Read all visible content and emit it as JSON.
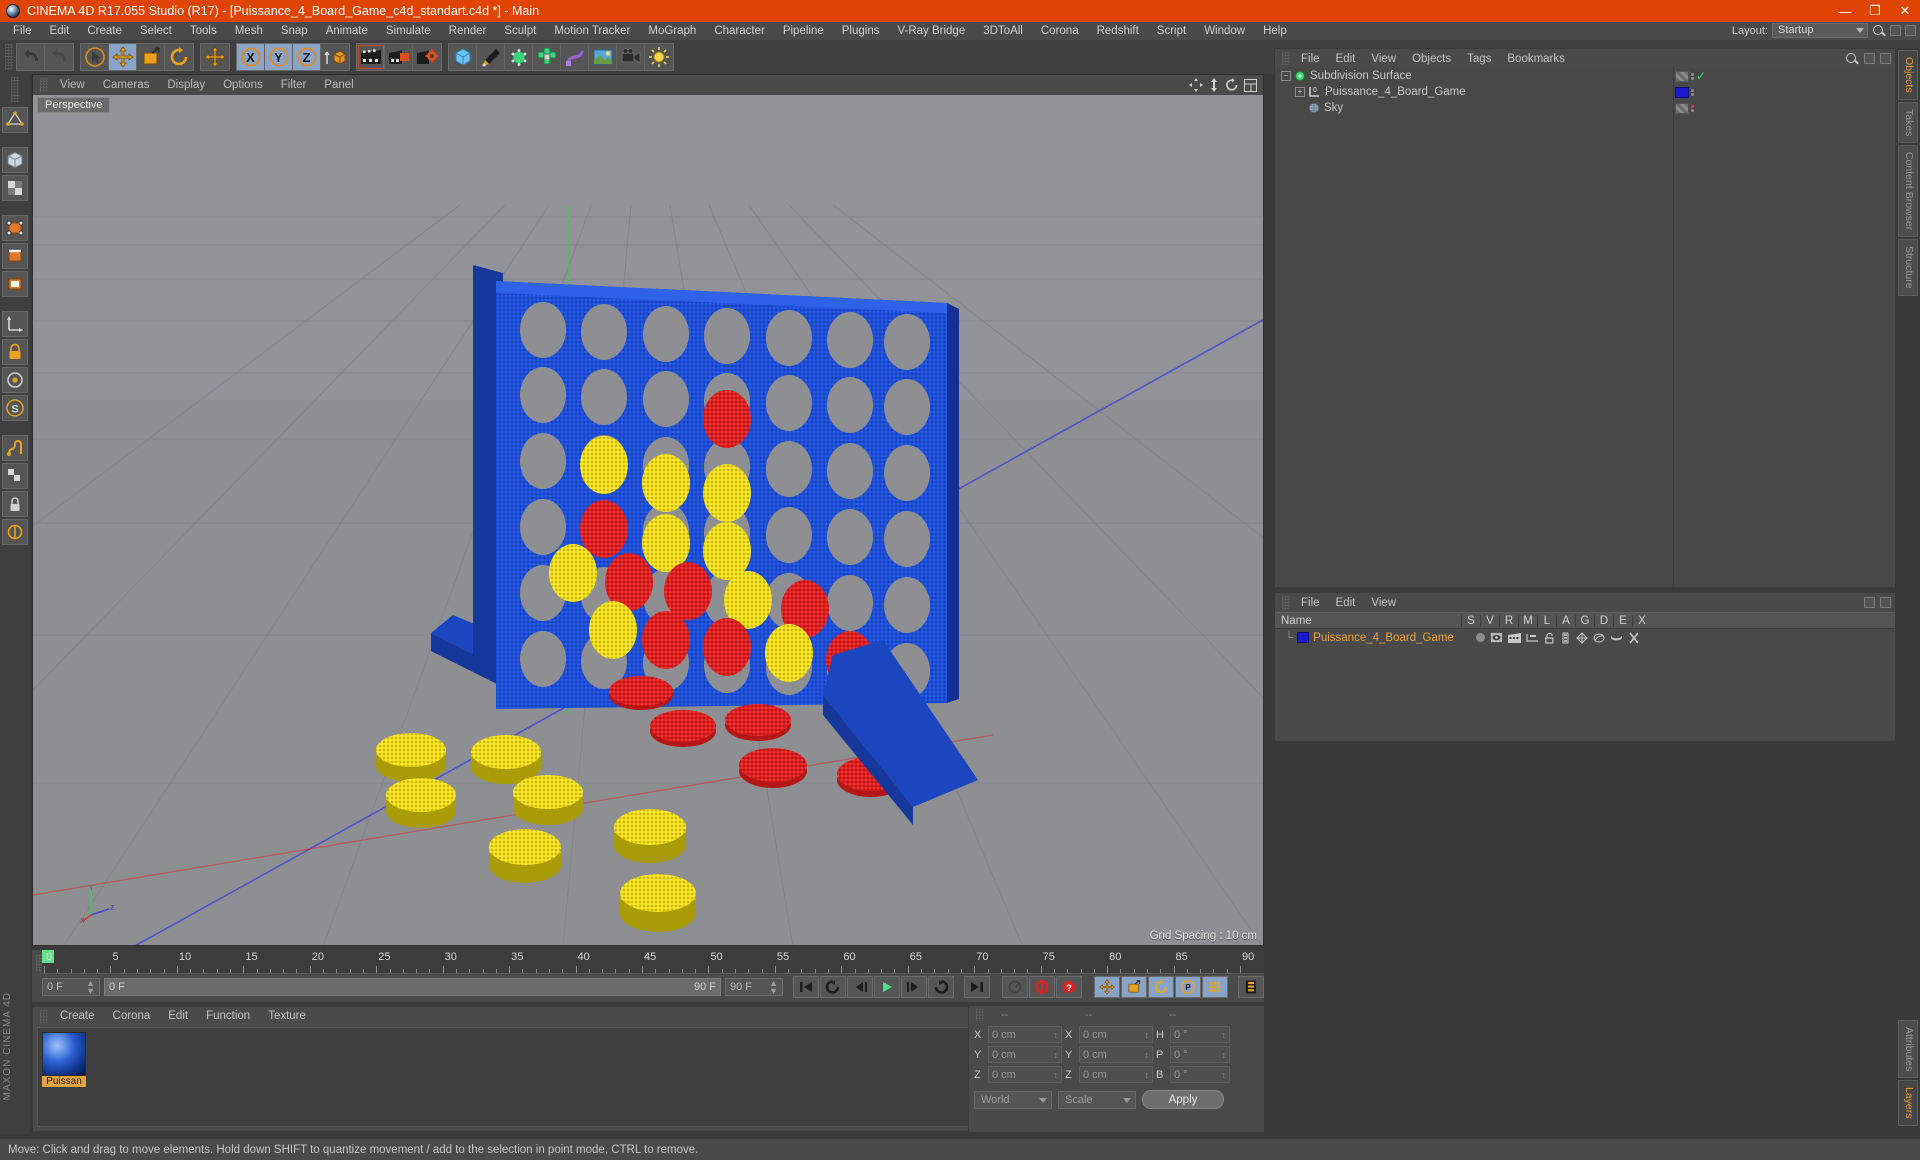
{
  "window": {
    "title": "CINEMA 4D R17.055 Studio (R17) - [Puissance_4_Board_Game_c4d_standart.c4d *] - Main",
    "minimize": "—",
    "maximize": "❐",
    "close": "✕"
  },
  "menubar": {
    "items": [
      "File",
      "Edit",
      "Create",
      "Select",
      "Tools",
      "Mesh",
      "Snap",
      "Animate",
      "Simulate",
      "Render",
      "Sculpt",
      "Motion Tracker",
      "MoGraph",
      "Character",
      "Pipeline",
      "Plugins",
      "V-Ray Bridge",
      "3DToAll",
      "Corona",
      "Redshift",
      "Script",
      "Window",
      "Help"
    ],
    "layout_label": "Layout:",
    "layout_value": "Startup"
  },
  "toolbar": {
    "groups": [
      {
        "name": "history",
        "buttons": [
          {
            "name": "undo-button",
            "icon": "undo"
          },
          {
            "name": "redo-button",
            "icon": "redo"
          }
        ]
      },
      {
        "name": "transform",
        "buttons": [
          {
            "name": "select-tool-button",
            "icon": "cursor",
            "on": false
          },
          {
            "name": "move-tool-button",
            "icon": "move",
            "on": true
          },
          {
            "name": "scale-tool-button",
            "icon": "scale",
            "on": false
          },
          {
            "name": "rotate-tool-button",
            "icon": "rotate",
            "on": false
          }
        ]
      },
      {
        "name": "move-alt",
        "buttons": [
          {
            "name": "move-alt-button",
            "icon": "move",
            "on": false
          }
        ]
      },
      {
        "name": "axis-locks",
        "buttons": [
          {
            "name": "x-axis-button",
            "icon": "X",
            "on": true
          },
          {
            "name": "y-axis-button",
            "icon": "Y",
            "on": true
          },
          {
            "name": "z-axis-button",
            "icon": "Z",
            "on": true
          },
          {
            "name": "world-object-axis-button",
            "icon": "cube-axis",
            "on": false
          }
        ]
      },
      {
        "name": "render",
        "buttons": [
          {
            "name": "render-view-button",
            "icon": "clapper"
          },
          {
            "name": "render-to-picture-viewer-button",
            "icon": "clapper-red"
          },
          {
            "name": "render-settings-button",
            "icon": "clapper-gear"
          }
        ]
      },
      {
        "name": "objects",
        "buttons": [
          {
            "name": "add-cube-button",
            "icon": "cube-blue"
          },
          {
            "name": "add-spline-button",
            "icon": "pen"
          },
          {
            "name": "add-generator-button",
            "icon": "cube-green"
          },
          {
            "name": "add-array-button",
            "icon": "array-green"
          },
          {
            "name": "add-deformer-button",
            "icon": "deformer"
          },
          {
            "name": "add-environment-button",
            "icon": "environment"
          },
          {
            "name": "add-camera-button",
            "icon": "camera"
          },
          {
            "name": "add-light-button",
            "icon": "light"
          }
        ]
      }
    ]
  },
  "rail": {
    "buttons": [
      {
        "name": "make-editable-button",
        "icon": "editable"
      },
      {
        "name": "model-mode-button",
        "icon": "model"
      },
      {
        "name": "texture-mode-button",
        "icon": "texture"
      },
      {
        "name": "points-mode-button",
        "icon": "points"
      },
      {
        "name": "edges-mode-button",
        "icon": "edges"
      },
      {
        "name": "polygons-mode-button",
        "icon": "polygons"
      },
      {
        "name": "axis-modify-button",
        "icon": "axis"
      },
      {
        "name": "enable-lock-button",
        "icon": "lock-axis"
      },
      {
        "name": "viewport-solo-button",
        "icon": "solo"
      },
      {
        "name": "scale-tool-rail-button",
        "icon": "s-tool"
      },
      {
        "name": "snap-button",
        "icon": "snap"
      },
      {
        "name": "workplane-button",
        "icon": "workplane"
      },
      {
        "name": "lock-workplane-button",
        "icon": "lock-plane"
      },
      {
        "name": "pin-workplane-button",
        "icon": "pin-plane"
      }
    ],
    "brand": "MAXON CINEMA 4D"
  },
  "viewport": {
    "menu": [
      "View",
      "Cameras",
      "Display",
      "Options",
      "Filter",
      "Panel"
    ],
    "label": "Perspective",
    "grid_spacing": "Grid Spacing : 10 cm",
    "axis_x": "X",
    "axis_y": "Y",
    "axis_z": "Z",
    "icons": [
      "move-camera-icon",
      "dolly-camera-icon",
      "rotate-camera-icon",
      "layout-view-icon"
    ]
  },
  "timeline": {
    "ticks": [
      0,
      5,
      10,
      15,
      20,
      25,
      30,
      35,
      40,
      45,
      50,
      55,
      60,
      65,
      70,
      75,
      80,
      85,
      90
    ],
    "current_frame": "0 F",
    "range_start": "0 F",
    "range_end": "90 F",
    "end_frame": "90 F",
    "transport": [
      {
        "name": "go-to-start-button",
        "icon": "skip-start"
      },
      {
        "name": "previous-key-button",
        "icon": "prev-key"
      },
      {
        "name": "step-back-button",
        "icon": "step-back"
      },
      {
        "name": "play-button",
        "icon": "play"
      },
      {
        "name": "step-forward-button",
        "icon": "step-fwd"
      },
      {
        "name": "next-key-button",
        "icon": "next-key"
      },
      {
        "name": "go-to-end-button",
        "icon": "skip-end"
      }
    ],
    "record_tools": [
      {
        "name": "autokey-button",
        "icon": "key-gray",
        "on": false
      },
      {
        "name": "record-active-objects-button",
        "icon": "record-red",
        "on": false
      },
      {
        "name": "keyframe-selection-button",
        "icon": "question-red",
        "on": false
      }
    ],
    "key_tools": [
      {
        "name": "record-position-button",
        "icon": "move-orange",
        "on": true
      },
      {
        "name": "record-scale-button",
        "icon": "scale-orange",
        "on": true
      },
      {
        "name": "record-rotation-button",
        "icon": "rotate-orange",
        "on": true
      },
      {
        "name": "record-parameter-button",
        "icon": "param-p",
        "on": true
      },
      {
        "name": "record-pla-button",
        "icon": "pla-dots",
        "on": true
      },
      {
        "name": "timeline-toggle-button",
        "icon": "film-strip",
        "on": false
      }
    ]
  },
  "materials": {
    "menu": [
      "Create",
      "Corona",
      "Edit",
      "Function",
      "Texture"
    ],
    "items": [
      {
        "name": "Puissan",
        "full": "Puissance_4_Board_Game"
      }
    ]
  },
  "coordinates": {
    "headers": [
      "--",
      "--",
      "--"
    ],
    "rows": [
      {
        "label1": "X",
        "value1": "0 cm",
        "label2": "X",
        "value2": "0 cm",
        "label3": "H",
        "value3": "0 °"
      },
      {
        "label1": "Y",
        "value1": "0 cm",
        "label2": "Y",
        "value2": "0 cm",
        "label3": "P",
        "value3": "0 °"
      },
      {
        "label1": "Z",
        "value1": "0 cm",
        "label2": "Z",
        "value2": "0 cm",
        "label3": "B",
        "value3": "0 °"
      }
    ],
    "system": "World",
    "mode": "Scale",
    "apply": "Apply"
  },
  "object_manager": {
    "menu": [
      "File",
      "Edit",
      "View",
      "Objects",
      "Tags",
      "Bookmarks"
    ],
    "items": [
      {
        "name": "Subdivision Surface",
        "icon": "subdivision-surface-icon",
        "depth": 0,
        "expander": "−",
        "swatch": "stripe",
        "dots": true,
        "check": true
      },
      {
        "name": "Puissance_4_Board_Game",
        "icon": "null-object-icon",
        "depth": 1,
        "expander": "+",
        "swatch": "#1a1ad0",
        "dots": true,
        "check": false
      },
      {
        "name": "Sky",
        "icon": "sky-icon",
        "depth": 1,
        "expander": "",
        "swatch": "stripe",
        "dots": false,
        "check": false,
        "reddot": true
      }
    ]
  },
  "layer_manager": {
    "menu": [
      "File",
      "Edit",
      "View"
    ],
    "columns": [
      "Name",
      "S",
      "V",
      "R",
      "M",
      "L",
      "A",
      "G",
      "D",
      "E",
      "X"
    ],
    "rows": [
      {
        "name": "Puissance_4_Board_Game",
        "color": "#1a1ad0"
      }
    ]
  },
  "vtabs_top": [
    "Objects",
    "Takes",
    "Content Browser",
    "Structure"
  ],
  "vtabs_bottom": [
    "Attributes",
    "Layers"
  ],
  "statusbar": {
    "text": "Move: Click and drag to move elements. Hold down SHIFT to quantize movement / add to the selection in point mode, CTRL to remove."
  },
  "scene": {
    "board_color": "#1d4fd8",
    "red_chip": "#e02020",
    "yellow_chip": "#f5e010",
    "ground_color": "#8e9093",
    "board_cells_cols": 7,
    "board_cells_rows": 6,
    "board_state": [
      [
        "",
        "",
        "",
        "",
        "",
        "",
        ""
      ],
      [
        "",
        "",
        "",
        "R",
        "",
        "",
        ""
      ],
      [
        "",
        "Y",
        "Y",
        "Y",
        "",
        "",
        ""
      ],
      [
        "",
        "R",
        "Y",
        "Y",
        "",
        "",
        ""
      ],
      [
        "Y",
        "R",
        "R",
        "Y",
        "R",
        "",
        ""
      ],
      [
        "Y",
        "R",
        "R",
        "Y",
        "R",
        "R",
        ""
      ]
    ],
    "loose_yellow_chips": 7,
    "loose_red_chips": 5
  }
}
